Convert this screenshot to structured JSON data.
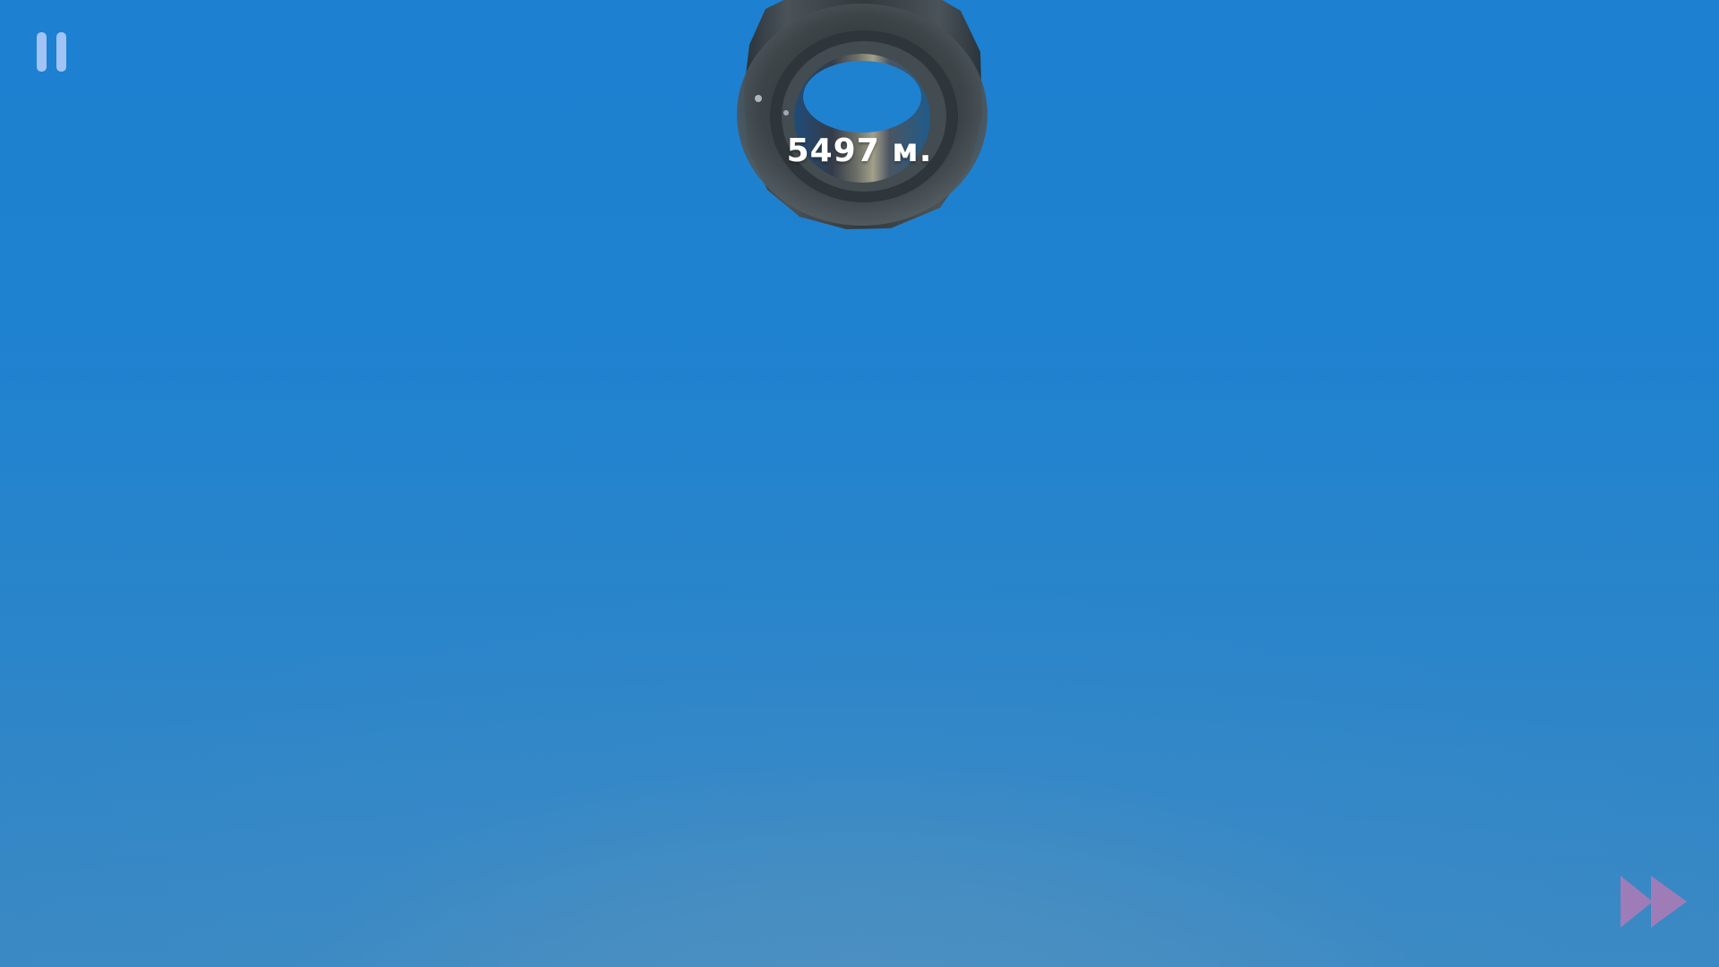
{
  "hud": {
    "distance_text": "5497 м.",
    "pause_icon": "pause-icon",
    "fast_forward_icon": "fast-forward-icon"
  },
  "colors": {
    "sky_top": "#1d80d0",
    "sky_bottom": "#4f91c0",
    "pause": "#bed2ff",
    "fast_forward": "#a77bb8",
    "tire": "#3b4247",
    "distance_text": "#ffffff"
  },
  "scene": {
    "object": "tire"
  }
}
